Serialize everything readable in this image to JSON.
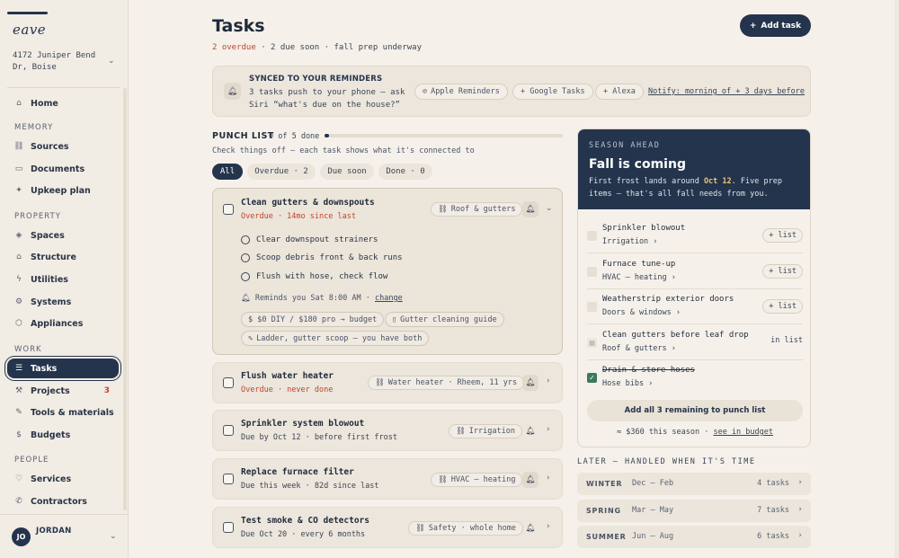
{
  "sidebar": {
    "logo": "eave",
    "address": "4172 Juniper Bend Dr, Boise",
    "items": [
      {
        "label": "Home"
      },
      {
        "label": "Sources"
      },
      {
        "label": "Documents"
      },
      {
        "label": "Upkeep plan"
      },
      {
        "label": "Spaces"
      },
      {
        "label": "Structure"
      },
      {
        "label": "Utilities"
      },
      {
        "label": "Systems"
      },
      {
        "label": "Appliances"
      },
      {
        "label": "Tasks"
      },
      {
        "label": "Projects",
        "badge": "3"
      },
      {
        "label": "Tools & materials"
      },
      {
        "label": "Budgets"
      },
      {
        "label": "Services"
      },
      {
        "label": "Contractors"
      }
    ],
    "sections": {
      "memory": "MEMORY",
      "property": "PROPERTY",
      "work": "WORK",
      "people": "PEOPLE"
    },
    "user": {
      "initials": "JO",
      "name": "JORDAN"
    }
  },
  "header": {
    "title": "Tasks",
    "add_label": "Add task",
    "overdue": "2 overdue",
    "rest": " · 2 due soon · fall prep underway"
  },
  "sync": {
    "title": "SYNCED TO YOUR REMINDERS",
    "desc": "3 tasks push to your phone — ask Siri “what's due on the house?”",
    "chips": [
      "Apple Reminders",
      "+ Google Tasks",
      "+ Alexa"
    ],
    "notify": "Notify: morning of + 3 days before"
  },
  "punch": {
    "title": "PUNCH LIST",
    "count": "0 of 5 done",
    "progress": 0.02,
    "desc": "Check things off — each task shows what it's connected to",
    "filters": [
      "All",
      "Overdue · 2",
      "Due soon",
      "Done · 0"
    ]
  },
  "tasks": [
    {
      "title": "Clean gutters & downspouts",
      "meta": "Overdue · 14mo since last",
      "chip": "Roof & gutters",
      "subtasks": [
        "Clear downspout strainers",
        "Scoop debris front & back runs",
        "Flush with hose, check flow"
      ],
      "remind": "Reminds you Sat 8:00 AM · ",
      "remind_link": "change",
      "pills": [
        "$ $0 DIY / $180 pro → budget",
        "Gutter cleaning guide",
        "Ladder, gutter scoop — you have both"
      ]
    },
    {
      "title": "Flush water heater",
      "meta": "Overdue · never done",
      "chip": "Water heater · Rheem, 11 yrs"
    },
    {
      "title": "Sprinkler system blowout",
      "meta": "Due by Oct 12 · before first frost",
      "chip": "Irrigation"
    },
    {
      "title": "Replace furnace filter",
      "meta": "Due this week · 82d since last",
      "chip": "HVAC — heating"
    },
    {
      "title": "Test smoke & CO detectors",
      "meta": "Due Oct 20 · every 6 months",
      "chip": "Safety · whole home"
    }
  ],
  "season": {
    "label": "SEASON AHEAD",
    "title": "Fall is coming",
    "desc_a": "First frost lands around ",
    "desc_date": "Oct 12",
    "desc_b": ". Five prep items — that's all fall needs from you.",
    "items": [
      {
        "title": "Sprinkler blowout",
        "sub": "Irrigation ›",
        "action": "+ list"
      },
      {
        "title": "Furnace tune-up",
        "sub": "HVAC — heating ›",
        "action": "+ list"
      },
      {
        "title": "Weatherstrip exterior doors",
        "sub": "Doors & windows ›",
        "action": "+ list"
      },
      {
        "title": "Clean gutters before leaf drop",
        "sub": "Roof & gutters ›",
        "action": "in list"
      },
      {
        "title": "Drain & store hoses",
        "sub": "Hose bibs ›",
        "action": ""
      }
    ],
    "add_all": "Add all 3 remaining to punch list",
    "budget_text": "≈ $360 this season · ",
    "budget_link": "see in budget"
  },
  "later": {
    "title": "LATER — HANDLED WHEN IT'S TIME",
    "rows": [
      {
        "season": "WINTER",
        "months": "Dec – Feb",
        "count": "4 tasks"
      },
      {
        "season": "SPRING",
        "months": "Mar – May",
        "count": "7 tasks"
      },
      {
        "season": "SUMMER",
        "months": "Jun – Aug",
        "count": "6 tasks"
      }
    ]
  },
  "colors": {
    "accent": "#24344c",
    "overdue": "#c1442c",
    "background": "#f5f1ea",
    "highlight": "#f1c27a",
    "done": "#3a7a5c"
  }
}
